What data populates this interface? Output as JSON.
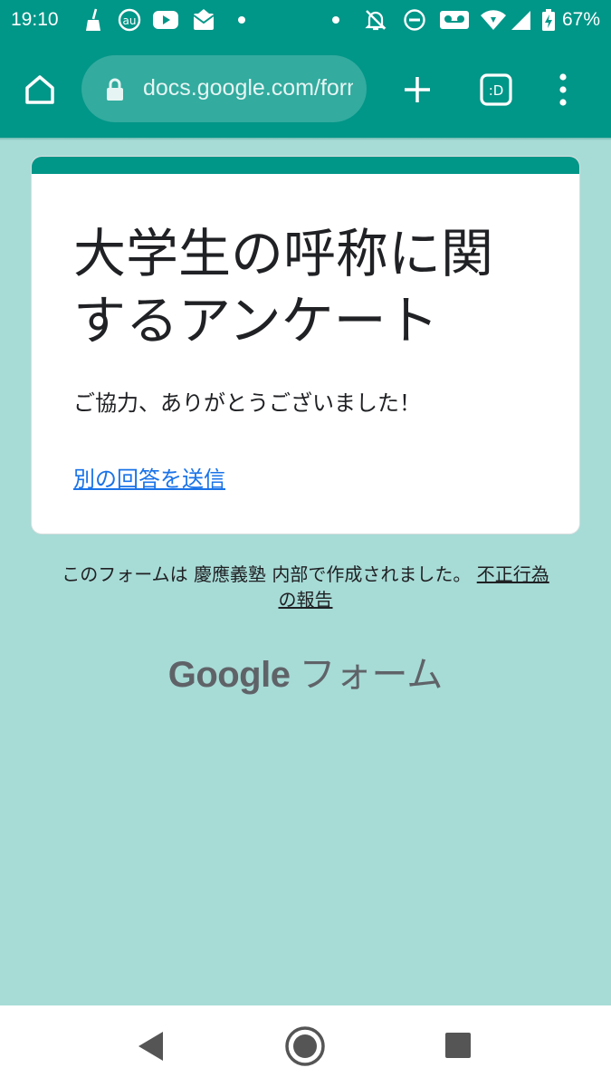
{
  "status_bar": {
    "time": "19:10",
    "battery_percent": "67%",
    "icons": [
      "broom-icon",
      "au-icon",
      "youtube-icon",
      "au-mail-icon",
      "dot-icon",
      "dot-icon",
      "notifications-off-icon",
      "do-not-disturb-icon",
      "voicemail-icon",
      "wifi-icon",
      "signal-icon",
      "battery-charging-icon"
    ]
  },
  "toolbar": {
    "url": "docs.google.com/forms",
    "icons": [
      "home-icon",
      "lock-icon",
      "new-tab-icon",
      "tab-switcher-icon",
      "more-vert-icon"
    ],
    "tab_switcher_label": ":D"
  },
  "card": {
    "title": "大学生の呼称に関するアンケート",
    "message": "ご協力、ありがとうございました！",
    "link_label": "別の回答を送信"
  },
  "footer": {
    "note": "このフォームは 慶應義塾 内部で作成されました。",
    "report_link": "不正行為の報告",
    "logo_google": "Google",
    "logo_product": "フォーム"
  },
  "nav_bar": {
    "icons": [
      "back-icon",
      "home-button-icon",
      "recents-icon"
    ]
  },
  "colors": {
    "accent": "#009688",
    "background": "#a7dbd6",
    "link": "#1a73e8"
  }
}
